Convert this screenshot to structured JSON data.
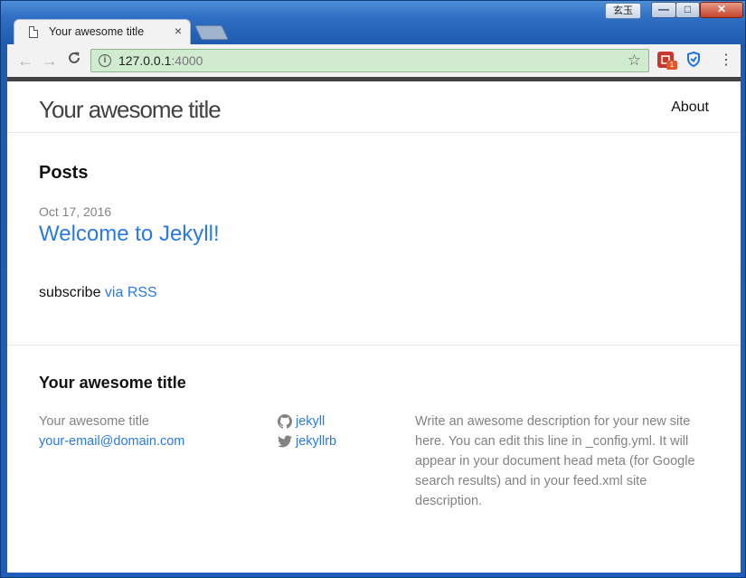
{
  "window": {
    "user_badge": "玄玉",
    "min_symbol": "—",
    "max_symbol": "□",
    "close_symbol": "✕"
  },
  "tab": {
    "title": "Your awesome title",
    "close_symbol": "×",
    "icon": "page-icon"
  },
  "toolbar": {
    "back_symbol": "←",
    "forward_symbol": "→",
    "reload_symbol": "C",
    "url_host": "127.0.0.1",
    "url_port": ":4000",
    "bookmark_symbol": "☆",
    "extension_badge": "1",
    "menu_symbol": "⋮"
  },
  "site": {
    "title": "Your awesome title",
    "nav_about": "About"
  },
  "main": {
    "heading": "Posts",
    "posts": [
      {
        "date": "Oct 17, 2016",
        "title": "Welcome to Jekyll!"
      }
    ],
    "rss_prefix": "subscribe ",
    "rss_link": "via RSS"
  },
  "footer": {
    "heading": "Your awesome title",
    "name": "Your awesome title",
    "email": "your-email@domain.com",
    "github": "jekyll",
    "twitter": "jekyllrb",
    "description": "Write an awesome description for your new site here. You can edit this line in _config.yml. It will appear in your document head meta (for Google search results) and in your feed.xml site description."
  },
  "colors": {
    "link": "#2a7ae2",
    "muted": "#828282",
    "text": "#111111",
    "header_bar": "#424242",
    "omnibox_bg": "#d1ebd0"
  }
}
